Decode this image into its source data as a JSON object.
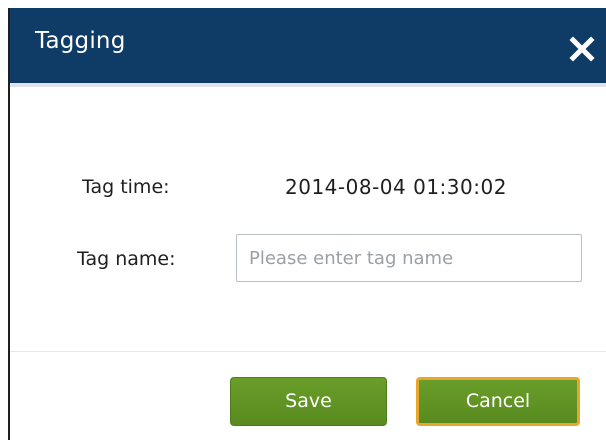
{
  "dialog": {
    "title": "Tagging",
    "close_icon": "close-icon"
  },
  "form": {
    "tag_time_label": "Tag time:",
    "tag_time_value": "2014-08-04 01:30:02",
    "tag_name_label": "Tag name:",
    "tag_name_value": "",
    "tag_name_placeholder": "Please enter tag name"
  },
  "buttons": {
    "save_label": "Save",
    "cancel_label": "Cancel"
  },
  "colors": {
    "titlebar": "#0f3c66",
    "button": "#5f9425",
    "focus_border": "#e8a62d"
  }
}
